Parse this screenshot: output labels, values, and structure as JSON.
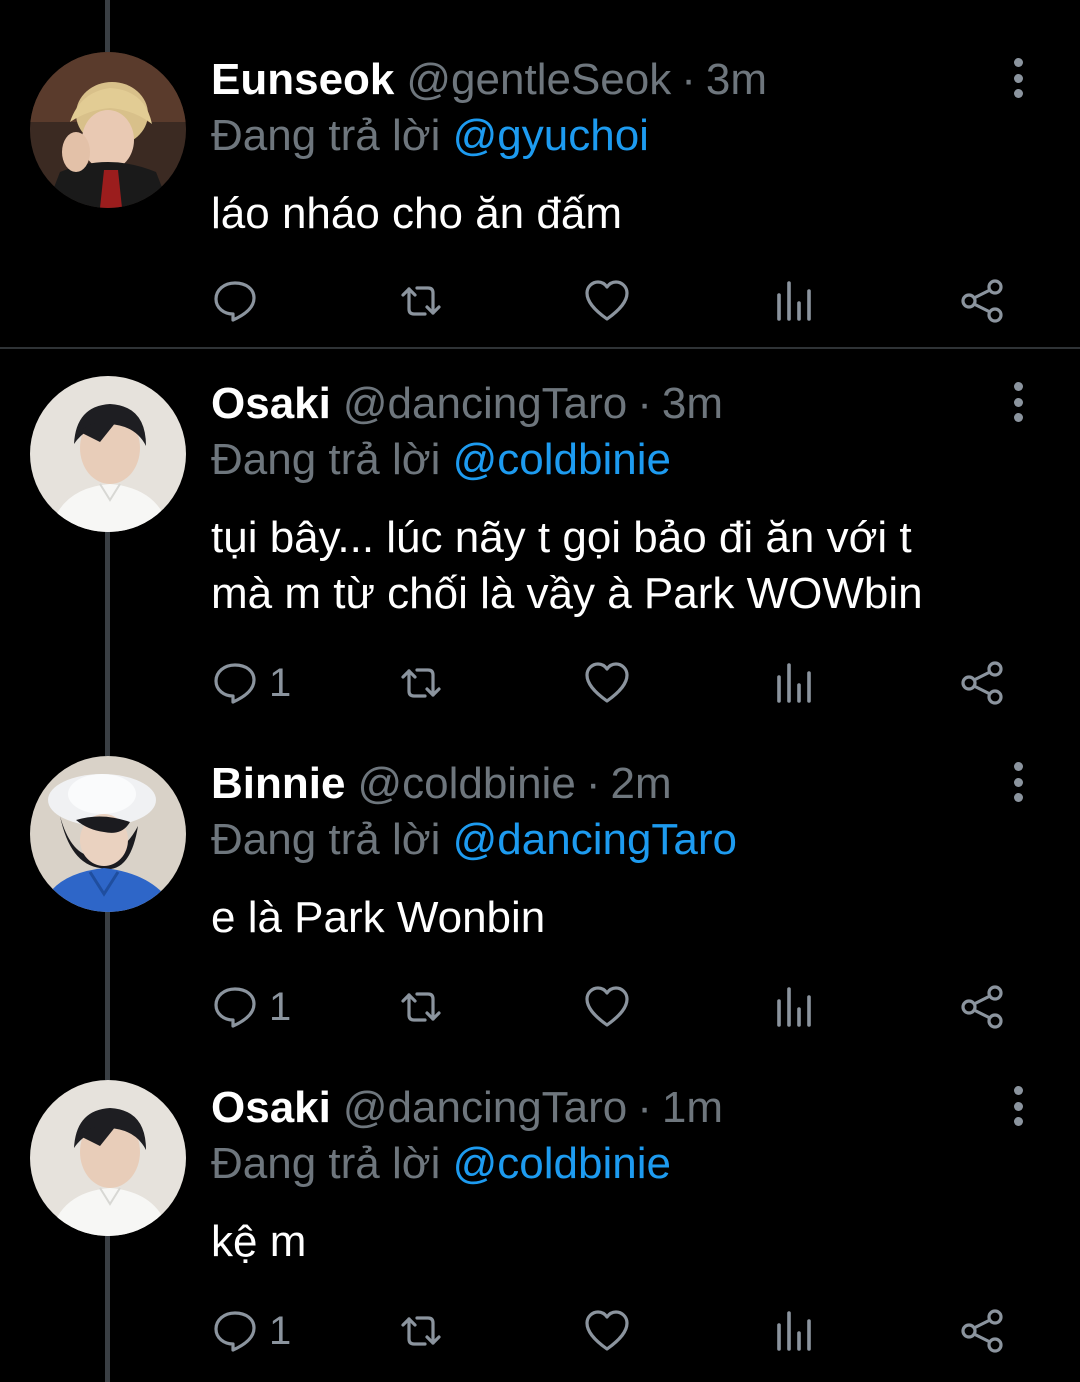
{
  "theme": {
    "background": "#000000",
    "text": "#ffffff",
    "muted": "#6e767d",
    "link": "#1d9bf0",
    "icon": "#8b949e"
  },
  "tweets": [
    {
      "display_name": "Eunseok",
      "handle": "@gentleSeok",
      "separator": "·",
      "time": "3m",
      "reply_prefix": "Đang trả lời",
      "reply_to": "@gyuchoi",
      "lines": [
        "láo nháo cho ăn đấm"
      ],
      "reply_count": "",
      "avatar": "avatar-eunseok"
    },
    {
      "display_name": "Osaki",
      "handle": "@dancingTaro",
      "separator": "·",
      "time": "3m",
      "reply_prefix": "Đang trả lời",
      "reply_to": "@coldbinie",
      "lines": [
        "tụi bây... lúc nãy t gọi bảo đi ăn với t",
        "mà m từ chối là vầy à Park WOWbin"
      ],
      "reply_count": "1",
      "avatar": "avatar-osaki"
    },
    {
      "display_name": "Binnie",
      "handle": "@coldbinie",
      "separator": "·",
      "time": "2m",
      "reply_prefix": "Đang trả lời",
      "reply_to": "@dancingTaro",
      "lines": [
        "e là Park Wonbin"
      ],
      "reply_count": "1",
      "avatar": "avatar-binnie"
    },
    {
      "display_name": "Osaki",
      "handle": "@dancingTaro",
      "separator": "·",
      "time": "1m",
      "reply_prefix": "Đang trả lời",
      "reply_to": "@coldbinie",
      "lines": [
        "kệ m"
      ],
      "reply_count": "1",
      "avatar": "avatar-osaki"
    }
  ],
  "icons": {
    "reply": "reply-bubble-icon",
    "retweet": "retweet-icon",
    "like": "heart-icon",
    "views": "analytics-icon",
    "share": "share-icon",
    "more": "more-vertical-icon"
  }
}
